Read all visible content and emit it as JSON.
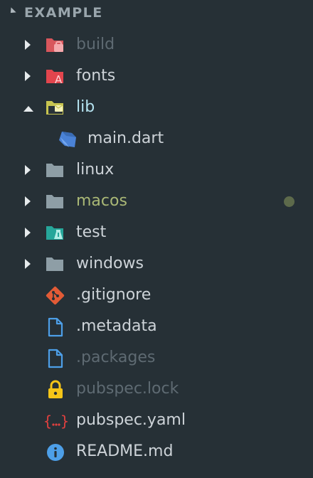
{
  "header": {
    "title": "EXAMPLE"
  },
  "colors": {
    "background": "#263036",
    "text": "#cdd3d8",
    "ignored": "#5e6a72",
    "folder_open_text": "#b5e3f0",
    "modified_text": "#aab876",
    "modified_dot": "#5d6a4b"
  },
  "items": [
    {
      "label": "build",
      "kind": "folder",
      "icon": "folder-red-package-icon"
    },
    {
      "label": "fonts",
      "kind": "folder",
      "icon": "folder-red-font-icon"
    },
    {
      "label": "lib",
      "kind": "folder",
      "icon": "folder-yellow-open-icon",
      "expanded": true
    },
    {
      "label": "main.dart",
      "kind": "file",
      "icon": "dart-icon"
    },
    {
      "label": "linux",
      "kind": "folder",
      "icon": "folder-gray-icon"
    },
    {
      "label": "macos",
      "kind": "folder",
      "icon": "folder-gray-icon",
      "status": "modified"
    },
    {
      "label": "test",
      "kind": "folder",
      "icon": "folder-teal-test-icon"
    },
    {
      "label": "windows",
      "kind": "folder",
      "icon": "folder-gray-icon"
    },
    {
      "label": ".gitignore",
      "kind": "file",
      "icon": "git-icon"
    },
    {
      "label": ".metadata",
      "kind": "file",
      "icon": "file-blue-icon"
    },
    {
      "label": ".packages",
      "kind": "file",
      "icon": "file-blue-icon"
    },
    {
      "label": "pubspec.lock",
      "kind": "file",
      "icon": "lock-icon"
    },
    {
      "label": "pubspec.yaml",
      "kind": "file",
      "icon": "yaml-braces-icon"
    },
    {
      "label": "README.md",
      "kind": "file",
      "icon": "info-icon"
    }
  ]
}
